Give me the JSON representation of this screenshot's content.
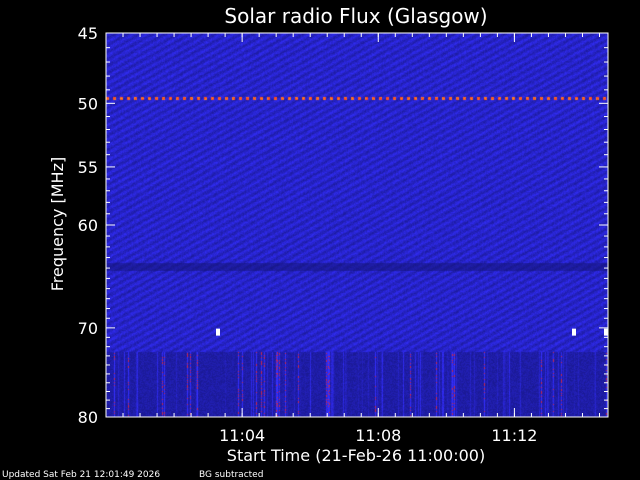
{
  "chart_data": {
    "type": "heatmap",
    "title": "Solar radio Flux (Glasgow)",
    "xlabel": "Start Time (21-Feb-26 11:00:00)",
    "ylabel": "Frequency [MHz]",
    "x_axis": {
      "unit": "time",
      "range": [
        "11:00:00",
        "11:14:45"
      ],
      "ticks": [
        "11:04",
        "11:08",
        "11:12"
      ]
    },
    "y_axis": {
      "unit": "MHz",
      "range": [
        45,
        80
      ],
      "scale": "log",
      "inverted": true,
      "ticks": [
        45,
        50,
        55,
        60,
        70,
        80
      ]
    },
    "grid": false,
    "background_color": "#000000",
    "colors": {
      "low": "#1a1aa0",
      "mid": "#2a2ae6",
      "high": "#ff3020",
      "saturated": "#ffffff",
      "axis": "#ffffff"
    },
    "features": {
      "interference_line_mhz": 49.6,
      "dark_band_mhz": [
        63.5,
        64.2
      ],
      "high_noise_band_mhz": [
        72.5,
        80
      ]
    }
  },
  "footer": {
    "updated": "Updated Sat Feb 21 12:01:49 2026",
    "note": "BG subtracted"
  }
}
